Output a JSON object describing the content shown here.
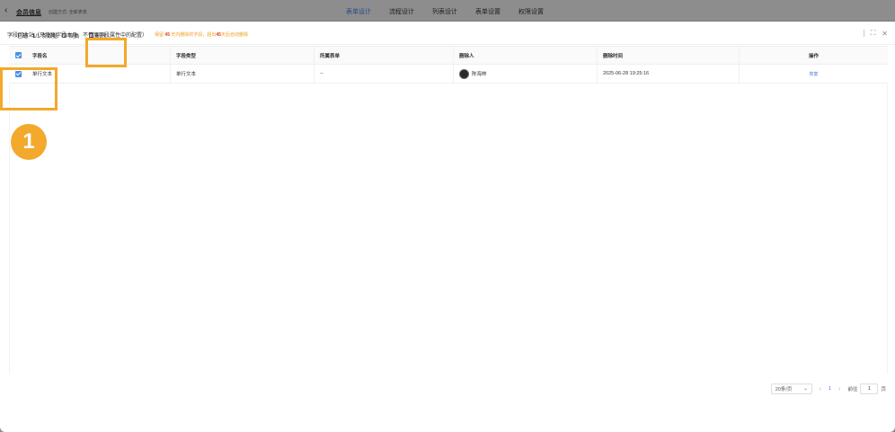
{
  "topbar": {
    "title": "会员信息",
    "subtitle": "创建方式: 全新表单",
    "tabs": [
      "表单设计",
      "流程设计",
      "列表设计",
      "表单设置",
      "权限设置"
    ]
  },
  "panel": {
    "title": "字段回收站（只恢复字段本身，不恢复字段属性中的配置）",
    "warn_prefix": "保留",
    "warn_days1": "45",
    "warn_mid": "天内删除的字段，超出",
    "warn_days2": "45",
    "warn_suffix": "天后自动删除"
  },
  "toolbar": {
    "selected_label": "已选",
    "count": "1",
    "total": "/1 条数据",
    "restore_label": "恢复",
    "delete_label": "删除"
  },
  "table": {
    "headers": [
      "字段名",
      "字段类型",
      "所属表单",
      "删除人",
      "删除时间",
      "操作"
    ],
    "rows": [
      {
        "name": "单行文本",
        "type": "单行文本",
        "form": "--",
        "user": "陈海林",
        "time": "2025-06-28 19:25:16",
        "op": "恢复"
      }
    ]
  },
  "pager": {
    "size": "20条/页",
    "page": "1",
    "goto_label": "前往",
    "goto_value": "1",
    "page_suffix": "页"
  },
  "annotation": {
    "step": "1"
  },
  "colors": {
    "accent": "#f2a92c",
    "link": "#3a7bd5",
    "checkbox": "#4a90e2"
  }
}
